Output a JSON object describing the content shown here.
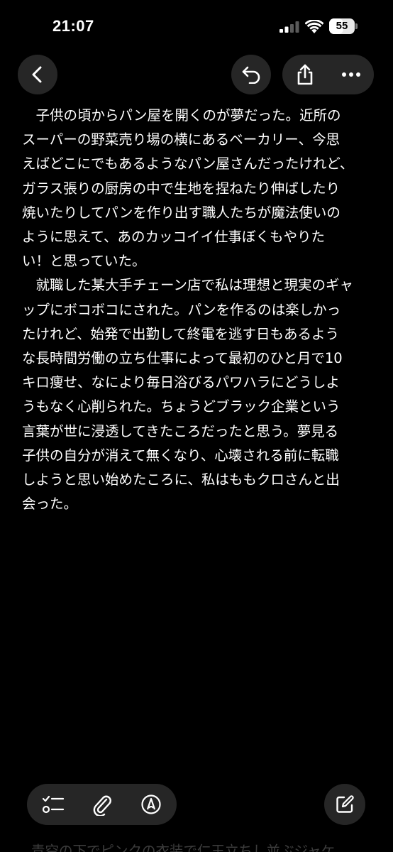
{
  "status_bar": {
    "time": "21:07",
    "battery": "55",
    "battery_level": 0.55,
    "icons": [
      "cellular-signal-icon",
      "wifi-icon",
      "battery-icon"
    ]
  },
  "toolbar_top": {
    "back_icon": "chevron-left-icon",
    "undo_icon": "undo-icon",
    "share_icon": "share-icon",
    "more_icon": "ellipsis-icon"
  },
  "note": {
    "paragraph_1": [
      "　子供の頃からパン屋を開くのが夢だった。近所の",
      "スーパーの野菜売り場の横にあるベーカリー、今思",
      "えばどこにでもあるようなパン屋さんだったけれど、",
      "ガラス張りの厨房の中で生地を捏ねたり伸ばしたり",
      "焼いたりしてパンを作り出す職人たちが魔法使いの",
      "ように思えて、あのカッコイイ仕事ぼくもやりた",
      "い！と思っていた。"
    ],
    "paragraph_2": [
      "　就職した某大手チェーン店で私は理想と現実のギャ",
      "ップにボコボコにされた。パンを作るのは楽しかっ",
      "たけれど、始発で出勤して終電を逃す日もあるよう",
      "な長時間労働の立ち仕事によって最初のひと月で10",
      "キロ痩せ、なにより毎日浴びるパワハラにどうしよ",
      "うもなく心削られた。ちょうどブラック企業という",
      "言葉が世に浸透してきたころだったと思う。夢見る",
      "子供の自分が消えて無くなり、心壊される前に転職",
      "しようと思い始めたころに、私はももクロさんと出",
      "会った。"
    ],
    "peek_line": "青空の下でピンクの衣装で仁王立ちし並ぶジャケ"
  },
  "toolbar_bottom": {
    "checklist_icon": "checklist-icon",
    "attach_icon": "paperclip-icon",
    "markup_icon": "markup-pen-icon",
    "compose_icon": "compose-icon"
  }
}
